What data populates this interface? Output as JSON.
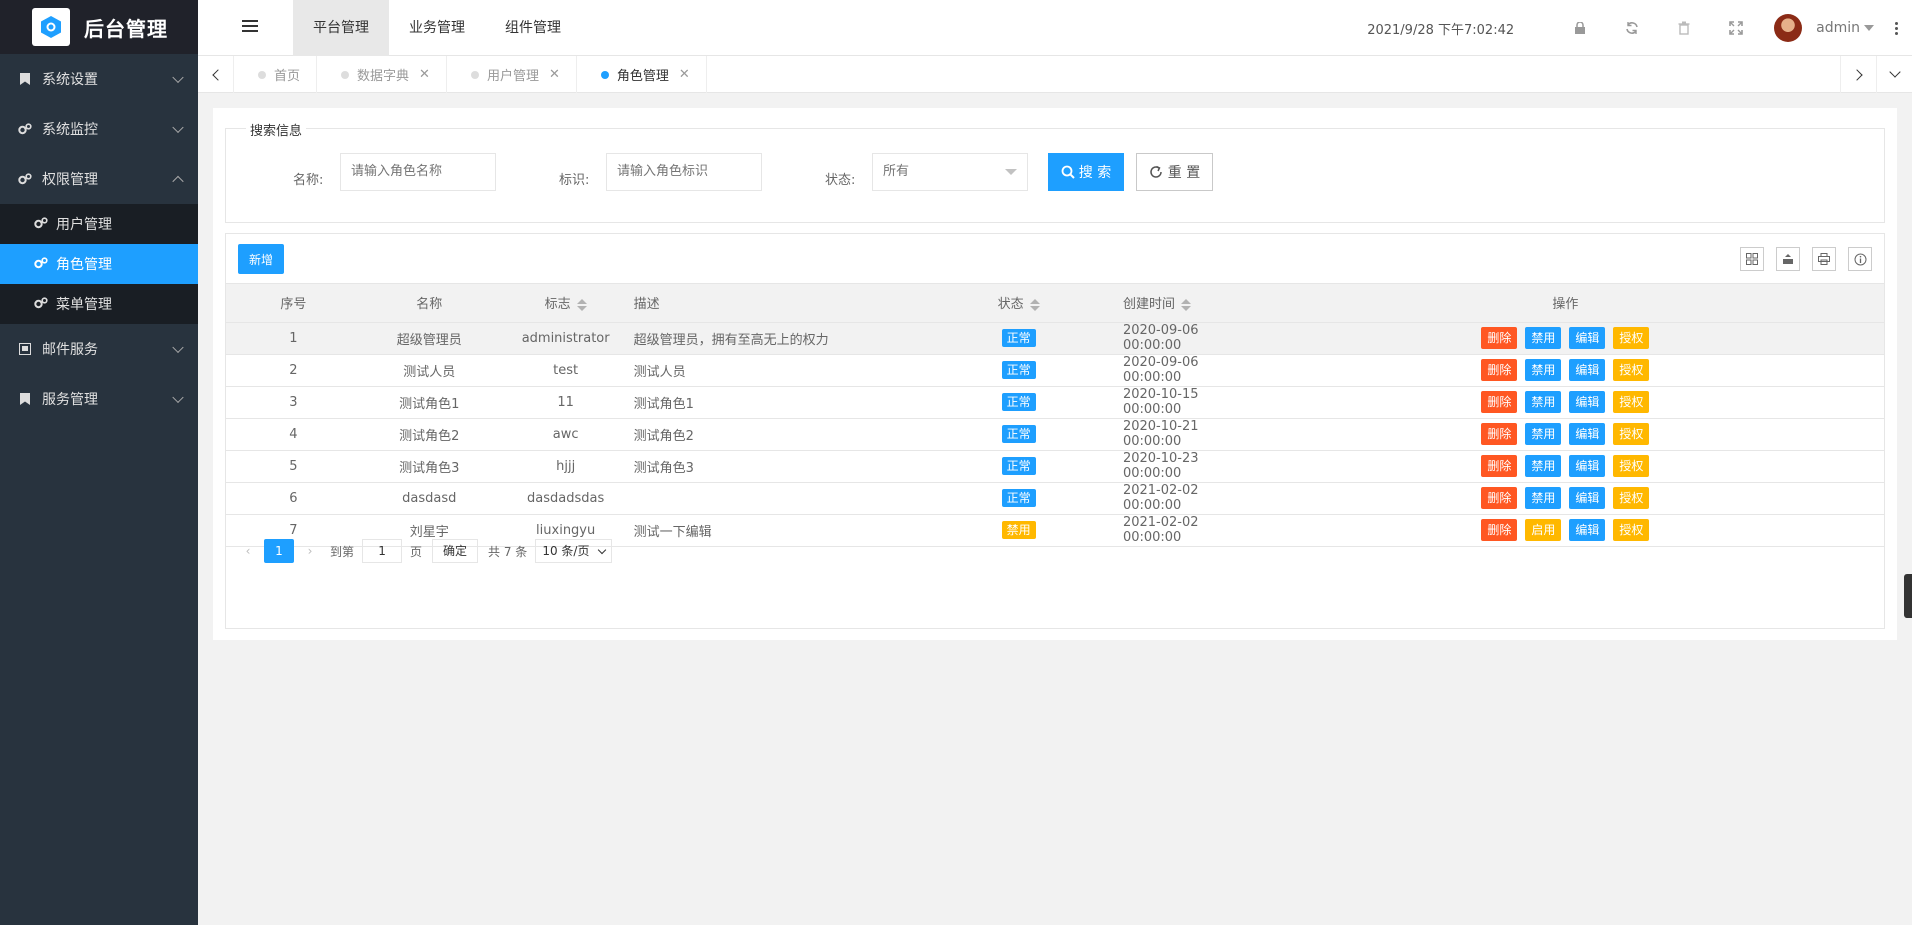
{
  "app": {
    "title": "后台管理"
  },
  "sidebar": {
    "items": [
      {
        "label": "系统设置",
        "icon": "bookmark-icon",
        "expanded": false
      },
      {
        "label": "系统监控",
        "icon": "gears-icon",
        "expanded": false
      },
      {
        "label": "权限管理",
        "icon": "gears-icon",
        "expanded": true,
        "children": [
          {
            "label": "用户管理",
            "active": false
          },
          {
            "label": "角色管理",
            "active": true
          },
          {
            "label": "菜单管理",
            "active": false
          }
        ]
      },
      {
        "label": "邮件服务",
        "icon": "mail-icon",
        "expanded": false
      },
      {
        "label": "服务管理",
        "icon": "bookmark-icon",
        "expanded": false
      }
    ]
  },
  "header": {
    "nav": [
      "平台管理",
      "业务管理",
      "组件管理"
    ],
    "active_nav": "平台管理",
    "datetime": "2021/9/28 下午7:02:42",
    "user": "admin"
  },
  "tabs": [
    {
      "label": "首页",
      "closable": false,
      "active": false
    },
    {
      "label": "数据字典",
      "closable": true,
      "active": false
    },
    {
      "label": "用户管理",
      "closable": true,
      "active": false
    },
    {
      "label": "角色管理",
      "closable": true,
      "active": true
    }
  ],
  "search": {
    "legend": "搜索信息",
    "name_label": "名称:",
    "name_placeholder": "请输入角色名称",
    "key_label": "标识:",
    "key_placeholder": "请输入角色标识",
    "status_label": "状态:",
    "status_value": "所有",
    "search_button": "搜 索",
    "reset_button": "重 置"
  },
  "table": {
    "add_button": "新增",
    "columns": [
      "序号",
      "名称",
      "标志",
      "描述",
      "状态",
      "创建时间",
      "操作"
    ],
    "rows": [
      {
        "no": "1",
        "name": "超级管理员",
        "key": "administrator",
        "desc": "超级管理员，拥有至高无上的权力",
        "status": "正常",
        "created": "2020-09-06 00:00:00",
        "toggle": "禁用"
      },
      {
        "no": "2",
        "name": "测试人员",
        "key": "test",
        "desc": "测试人员",
        "status": "正常",
        "created": "2020-09-06 00:00:00",
        "toggle": "禁用"
      },
      {
        "no": "3",
        "name": "测试角色1",
        "key": "11",
        "desc": "测试角色1",
        "status": "正常",
        "created": "2020-10-15 00:00:00",
        "toggle": "禁用"
      },
      {
        "no": "4",
        "name": "测试角色2",
        "key": "awc",
        "desc": "测试角色2",
        "status": "正常",
        "created": "2020-10-21 00:00:00",
        "toggle": "禁用"
      },
      {
        "no": "5",
        "name": "测试角色3",
        "key": "hjjj",
        "desc": "测试角色3",
        "status": "正常",
        "created": "2020-10-23 00:00:00",
        "toggle": "禁用"
      },
      {
        "no": "6",
        "name": "dasdasd",
        "key": "dasdadsdas",
        "desc": "",
        "status": "正常",
        "created": "2021-02-02 00:00:00",
        "toggle": "禁用"
      },
      {
        "no": "7",
        "name": "刘星宇",
        "key": "liuxingyu",
        "desc": "测试一下编辑",
        "status": "禁用",
        "created": "2021-02-02 00:00:00",
        "toggle": "启用"
      }
    ],
    "actions": {
      "delete": "删除",
      "edit": "编辑",
      "grant": "授权"
    }
  },
  "pager": {
    "current": "1",
    "goto_label": "到第",
    "goto_value": "1",
    "page_unit": "页",
    "confirm": "确定",
    "total": "共 7 条",
    "page_size": "10 条/页"
  },
  "colors": {
    "primary": "#1e9fff",
    "danger": "#ff5722",
    "warn": "#ffb800",
    "sidebar": "#28333e"
  }
}
